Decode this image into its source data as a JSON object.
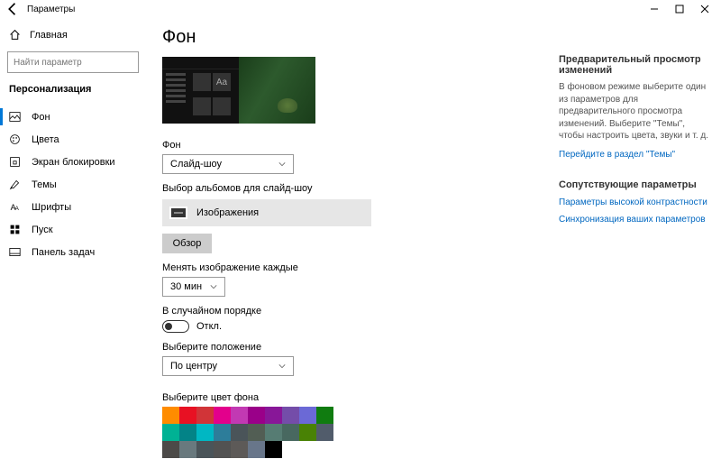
{
  "window": {
    "title": "Параметры",
    "min": "—",
    "max": "☐",
    "close": "✕"
  },
  "sidebar": {
    "home": "Главная",
    "search_placeholder": "Найти параметр",
    "section": "Персонализация",
    "items": [
      {
        "label": "Фон"
      },
      {
        "label": "Цвета"
      },
      {
        "label": "Экран блокировки"
      },
      {
        "label": "Темы"
      },
      {
        "label": "Шрифты"
      },
      {
        "label": "Пуск"
      },
      {
        "label": "Панель задач"
      }
    ]
  },
  "main": {
    "title": "Фон",
    "bg_label": "Фон",
    "bg_value": "Слайд-шоу",
    "album_label": "Выбор альбомов для слайд-шоу",
    "album_value": "Изображения",
    "browse": "Обзор",
    "interval_label": "Менять изображение каждые",
    "interval_value": "30 мин",
    "shuffle_label": "В случайном порядке",
    "shuffle_value": "Откл.",
    "fit_label": "Выберите положение",
    "fit_value": "По центру",
    "color_label": "Выберите цвет фона",
    "colors_row1": [
      "#ff8c00",
      "#e81123",
      "#d13438",
      "#e3008c",
      "#c239b3",
      "#9a0089",
      "#881798",
      "#744da9",
      "#6b69d6"
    ],
    "colors_row2": [
      "#107c10",
      "#00b294",
      "#038387",
      "#00b7c3",
      "#2d7d9a",
      "#4a5459",
      "#525e54",
      "#567c73",
      "#486860"
    ],
    "colors_row3": [
      "#498205",
      "#515c6b",
      "#4c4a48",
      "#69797e",
      "#4a5459",
      "#525252",
      "#5d5a58",
      "#68768a",
      "#000000"
    ]
  },
  "right": {
    "head1": "Предварительный просмотр изменений",
    "p1": "В фоновом режиме выберите один из параметров для предварительного просмотра изменений. Выберите \"Темы\", чтобы настроить цвета, звуки и т. д.",
    "link1": "Перейдите в раздел \"Темы\"",
    "head2": "Сопутствующие параметры",
    "link2": "Параметры высокой контрастности",
    "link3": "Синхронизация ваших параметров"
  }
}
